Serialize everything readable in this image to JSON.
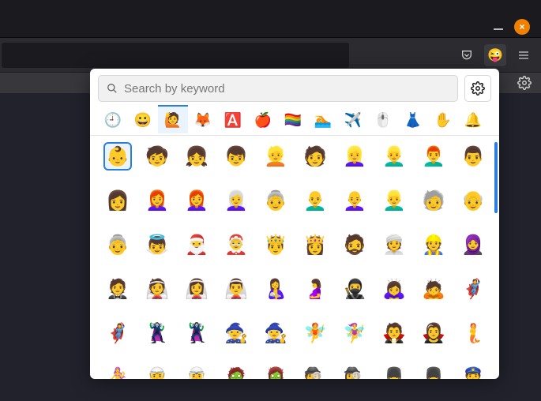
{
  "window": {
    "close_label": "×"
  },
  "search": {
    "placeholder": "Search by keyword"
  },
  "categories": [
    {
      "name": "recent",
      "glyph": "🕘"
    },
    {
      "name": "smileys",
      "glyph": "😀"
    },
    {
      "name": "people",
      "glyph": "🙋",
      "active": true
    },
    {
      "name": "animals",
      "glyph": "🦊"
    },
    {
      "name": "letters",
      "glyph": "🅰️"
    },
    {
      "name": "food",
      "glyph": "🍎"
    },
    {
      "name": "flags",
      "glyph": "🏳️‍🌈"
    },
    {
      "name": "activity",
      "glyph": "🏊"
    },
    {
      "name": "travel",
      "glyph": "✈️"
    },
    {
      "name": "objects",
      "glyph": "🖱️"
    },
    {
      "name": "clothing",
      "glyph": "👗"
    },
    {
      "name": "body",
      "glyph": "✋"
    },
    {
      "name": "symbols",
      "glyph": "🔔"
    }
  ],
  "grid": [
    [
      "👶",
      "🧒",
      "👧",
      "👦",
      "👱",
      "🧑",
      "👱‍♀️",
      "👱‍♂️",
      "👨‍🦰",
      "👨"
    ],
    [
      "👩",
      "👩‍🦰",
      "👩‍🦰",
      "👩‍🦳",
      "👵",
      "👨‍🦲",
      "👩‍🦲",
      "👱‍♂️",
      "🧓",
      "👴"
    ],
    [
      "👵",
      "👼",
      "🎅",
      "🤶",
      "🤴",
      "👸",
      "🧔",
      "👳",
      "👷",
      "🧕"
    ],
    [
      "🤵",
      "👰",
      "👰‍♀️",
      "👰‍♂️",
      "🤱",
      "🤰",
      "🥷",
      "🙇‍♀️",
      "🙇",
      "🦸"
    ],
    [
      "🦸‍♀️",
      "🦹",
      "🦹‍♀️",
      "🧙",
      "🧙‍♀️",
      "🧚",
      "🧚‍♀️",
      "🧛",
      "🧛‍♀️",
      "🧜"
    ],
    [
      "🧜‍♀️",
      "🧝",
      "🧝‍♀️",
      "🧟",
      "🧟‍♀️",
      "🕵️",
      "🕵️‍♀️",
      "💂",
      "💂‍♀️",
      "👮"
    ]
  ],
  "selected": [
    0,
    0
  ]
}
